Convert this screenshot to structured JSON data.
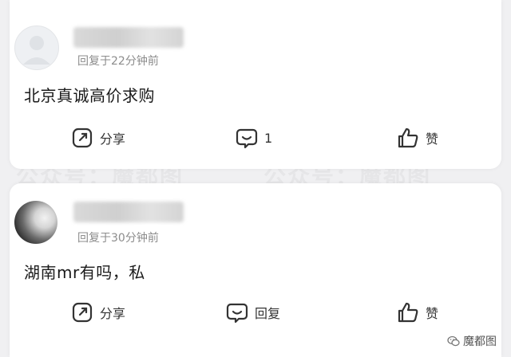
{
  "comments": [
    {
      "time": "回复于22分钟前",
      "text": "北京真诚高价求购",
      "actions": {
        "share": "分享",
        "comment_count": "1",
        "like": "赞"
      }
    },
    {
      "time": "回复于30分钟前",
      "text": "湖南mr有吗，私",
      "actions": {
        "share": "分享",
        "reply": "回复",
        "like": "赞"
      }
    }
  ],
  "watermark": "公众号：魔都图",
  "badge": {
    "label": "魔都图",
    "icon": "wechat-icon"
  },
  "icons": {
    "share": "share-edit-icon",
    "comment": "comment-bubble-icon",
    "like": "thumbs-up-icon",
    "avatar": "avatar-placeholder-icon"
  }
}
